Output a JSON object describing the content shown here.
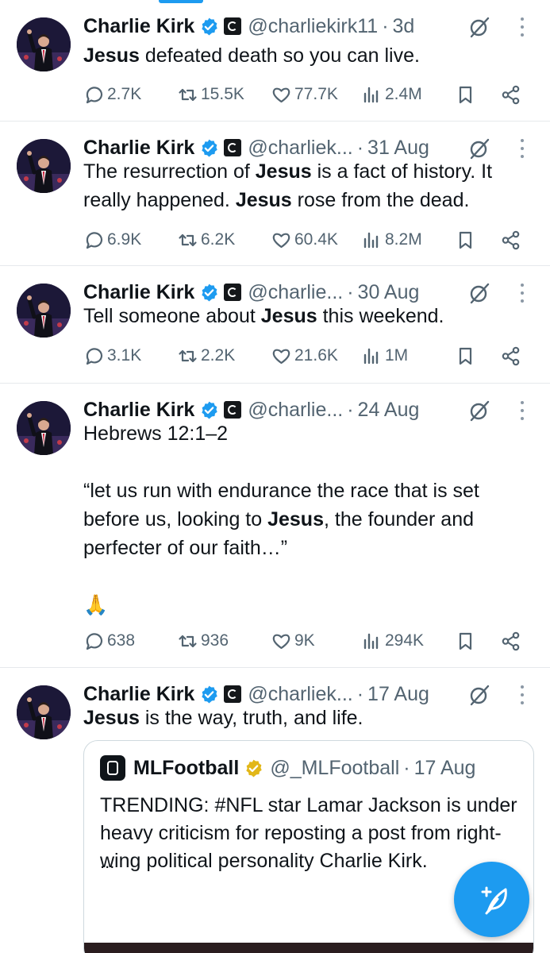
{
  "tweets": [
    {
      "name": "Charlie Kirk",
      "handle": "@charliekirk11",
      "date": "3d",
      "text": [
        {
          "b": "Jesus"
        },
        {
          "t": " defeated death so you can live."
        }
      ],
      "replies": "2.7K",
      "retweets": "15.5K",
      "likes": "77.7K",
      "views": "2.4M"
    },
    {
      "name": "Charlie Kirk",
      "handle": "@charliek...",
      "date": "31 Aug",
      "text": [
        {
          "t": "The resurrection of "
        },
        {
          "b": "Jesus"
        },
        {
          "t": " is a fact of history. It really happened. "
        },
        {
          "b": "Jesus"
        },
        {
          "t": " rose from the dead."
        }
      ],
      "replies": "6.9K",
      "retweets": "6.2K",
      "likes": "60.4K",
      "views": "8.2M"
    },
    {
      "name": "Charlie Kirk",
      "handle": "@charlie...",
      "date": "30 Aug",
      "text": [
        {
          "t": "Tell someone about "
        },
        {
          "b": "Jesus"
        },
        {
          "t": " this weekend."
        }
      ],
      "replies": "3.1K",
      "retweets": "2.2K",
      "likes": "21.6K",
      "views": "1M"
    },
    {
      "name": "Charlie Kirk",
      "handle": "@charlie...",
      "date": "24 Aug",
      "text": [
        {
          "t": "Hebrews 12:1–2"
        },
        {
          "br": 2
        },
        {
          "t": "“let us run with endurance the race that is set before us, looking to "
        },
        {
          "b": "Jesus"
        },
        {
          "t": ", the founder and perfecter of our faith…”"
        },
        {
          "br": 2
        },
        {
          "t": "🙏"
        }
      ],
      "replies": "638",
      "retweets": "936",
      "likes": "9K",
      "views": "294K"
    },
    {
      "name": "Charlie Kirk",
      "handle": "@charliek...",
      "date": "17 Aug",
      "text": [
        {
          "b": "Jesus"
        },
        {
          "t": " is the way, truth, and life."
        }
      ]
    }
  ],
  "quote": {
    "name": "MLFootball",
    "handle": "@_MLFootball",
    "date": "17 Aug",
    "text": "TRENDING: #NFL star Lamar Jackson is under heavy criticism for reposting a post from right-wing political personality Charlie Kirk.",
    "ellipsis": "..."
  },
  "separator": "·",
  "colors": {
    "accent": "#1d9bf0",
    "text": "#0f1419",
    "secondary": "#536471",
    "gold_badge": "#e2b719"
  },
  "icons": {
    "reply": "speech-bubble-icon",
    "retweet": "retweet-icon",
    "like": "heart-icon",
    "views": "bar-chart-icon",
    "bookmark": "bookmark-icon",
    "share": "share-icon",
    "grok": "grok-icon",
    "more": "more-vertical-icon",
    "compose": "compose-feather-icon"
  }
}
